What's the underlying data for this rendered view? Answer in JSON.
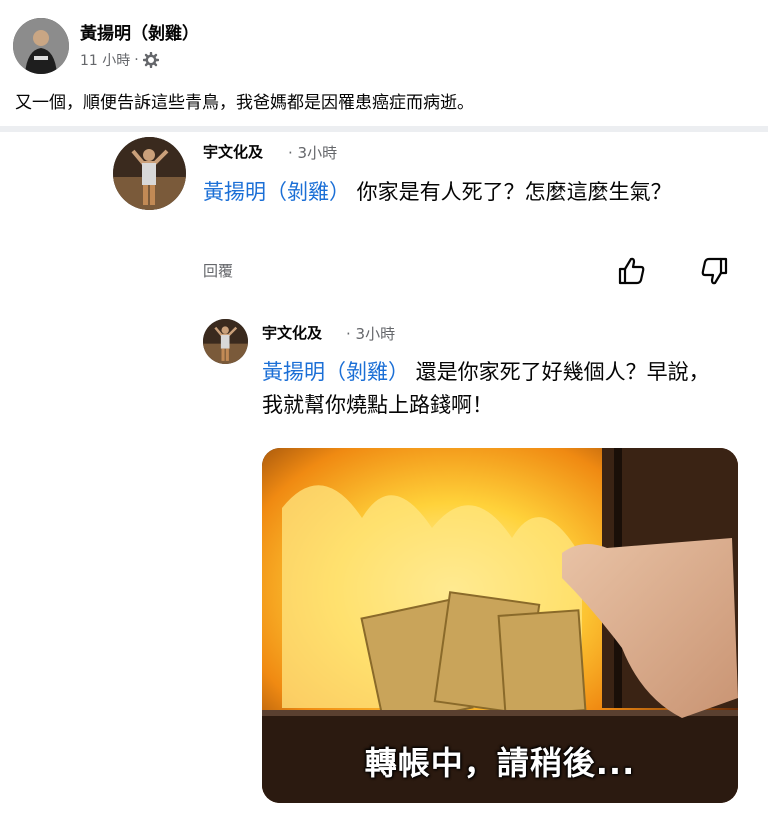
{
  "post": {
    "author": "黃揚明（剝雞）",
    "time": "11 小時",
    "separator": "·",
    "text": "又一個，順便告訴這些青鳥，我爸媽都是因罹患癌症而病逝。"
  },
  "comment1": {
    "author": "宇文化及",
    "time": "· 3小時",
    "mention": "黃揚明（剝雞）",
    "text": " 你家是有人死了？怎麼這麼生氣？",
    "reply_label": "回覆",
    "icons": [
      "like-icon",
      "dislike-icon"
    ]
  },
  "comment2": {
    "author": "宇文化及",
    "time": "· 3小時",
    "mention": "黃揚明（剝雞）",
    "text": " 還是你家死了好幾個人？早說，我就幫你燒點上路錢啊！",
    "image_caption": "轉帳中，請稍後..."
  },
  "colors": {
    "mention": "#1b6fd6",
    "secondary_text": "#65676b",
    "divider": "#eceef1"
  }
}
